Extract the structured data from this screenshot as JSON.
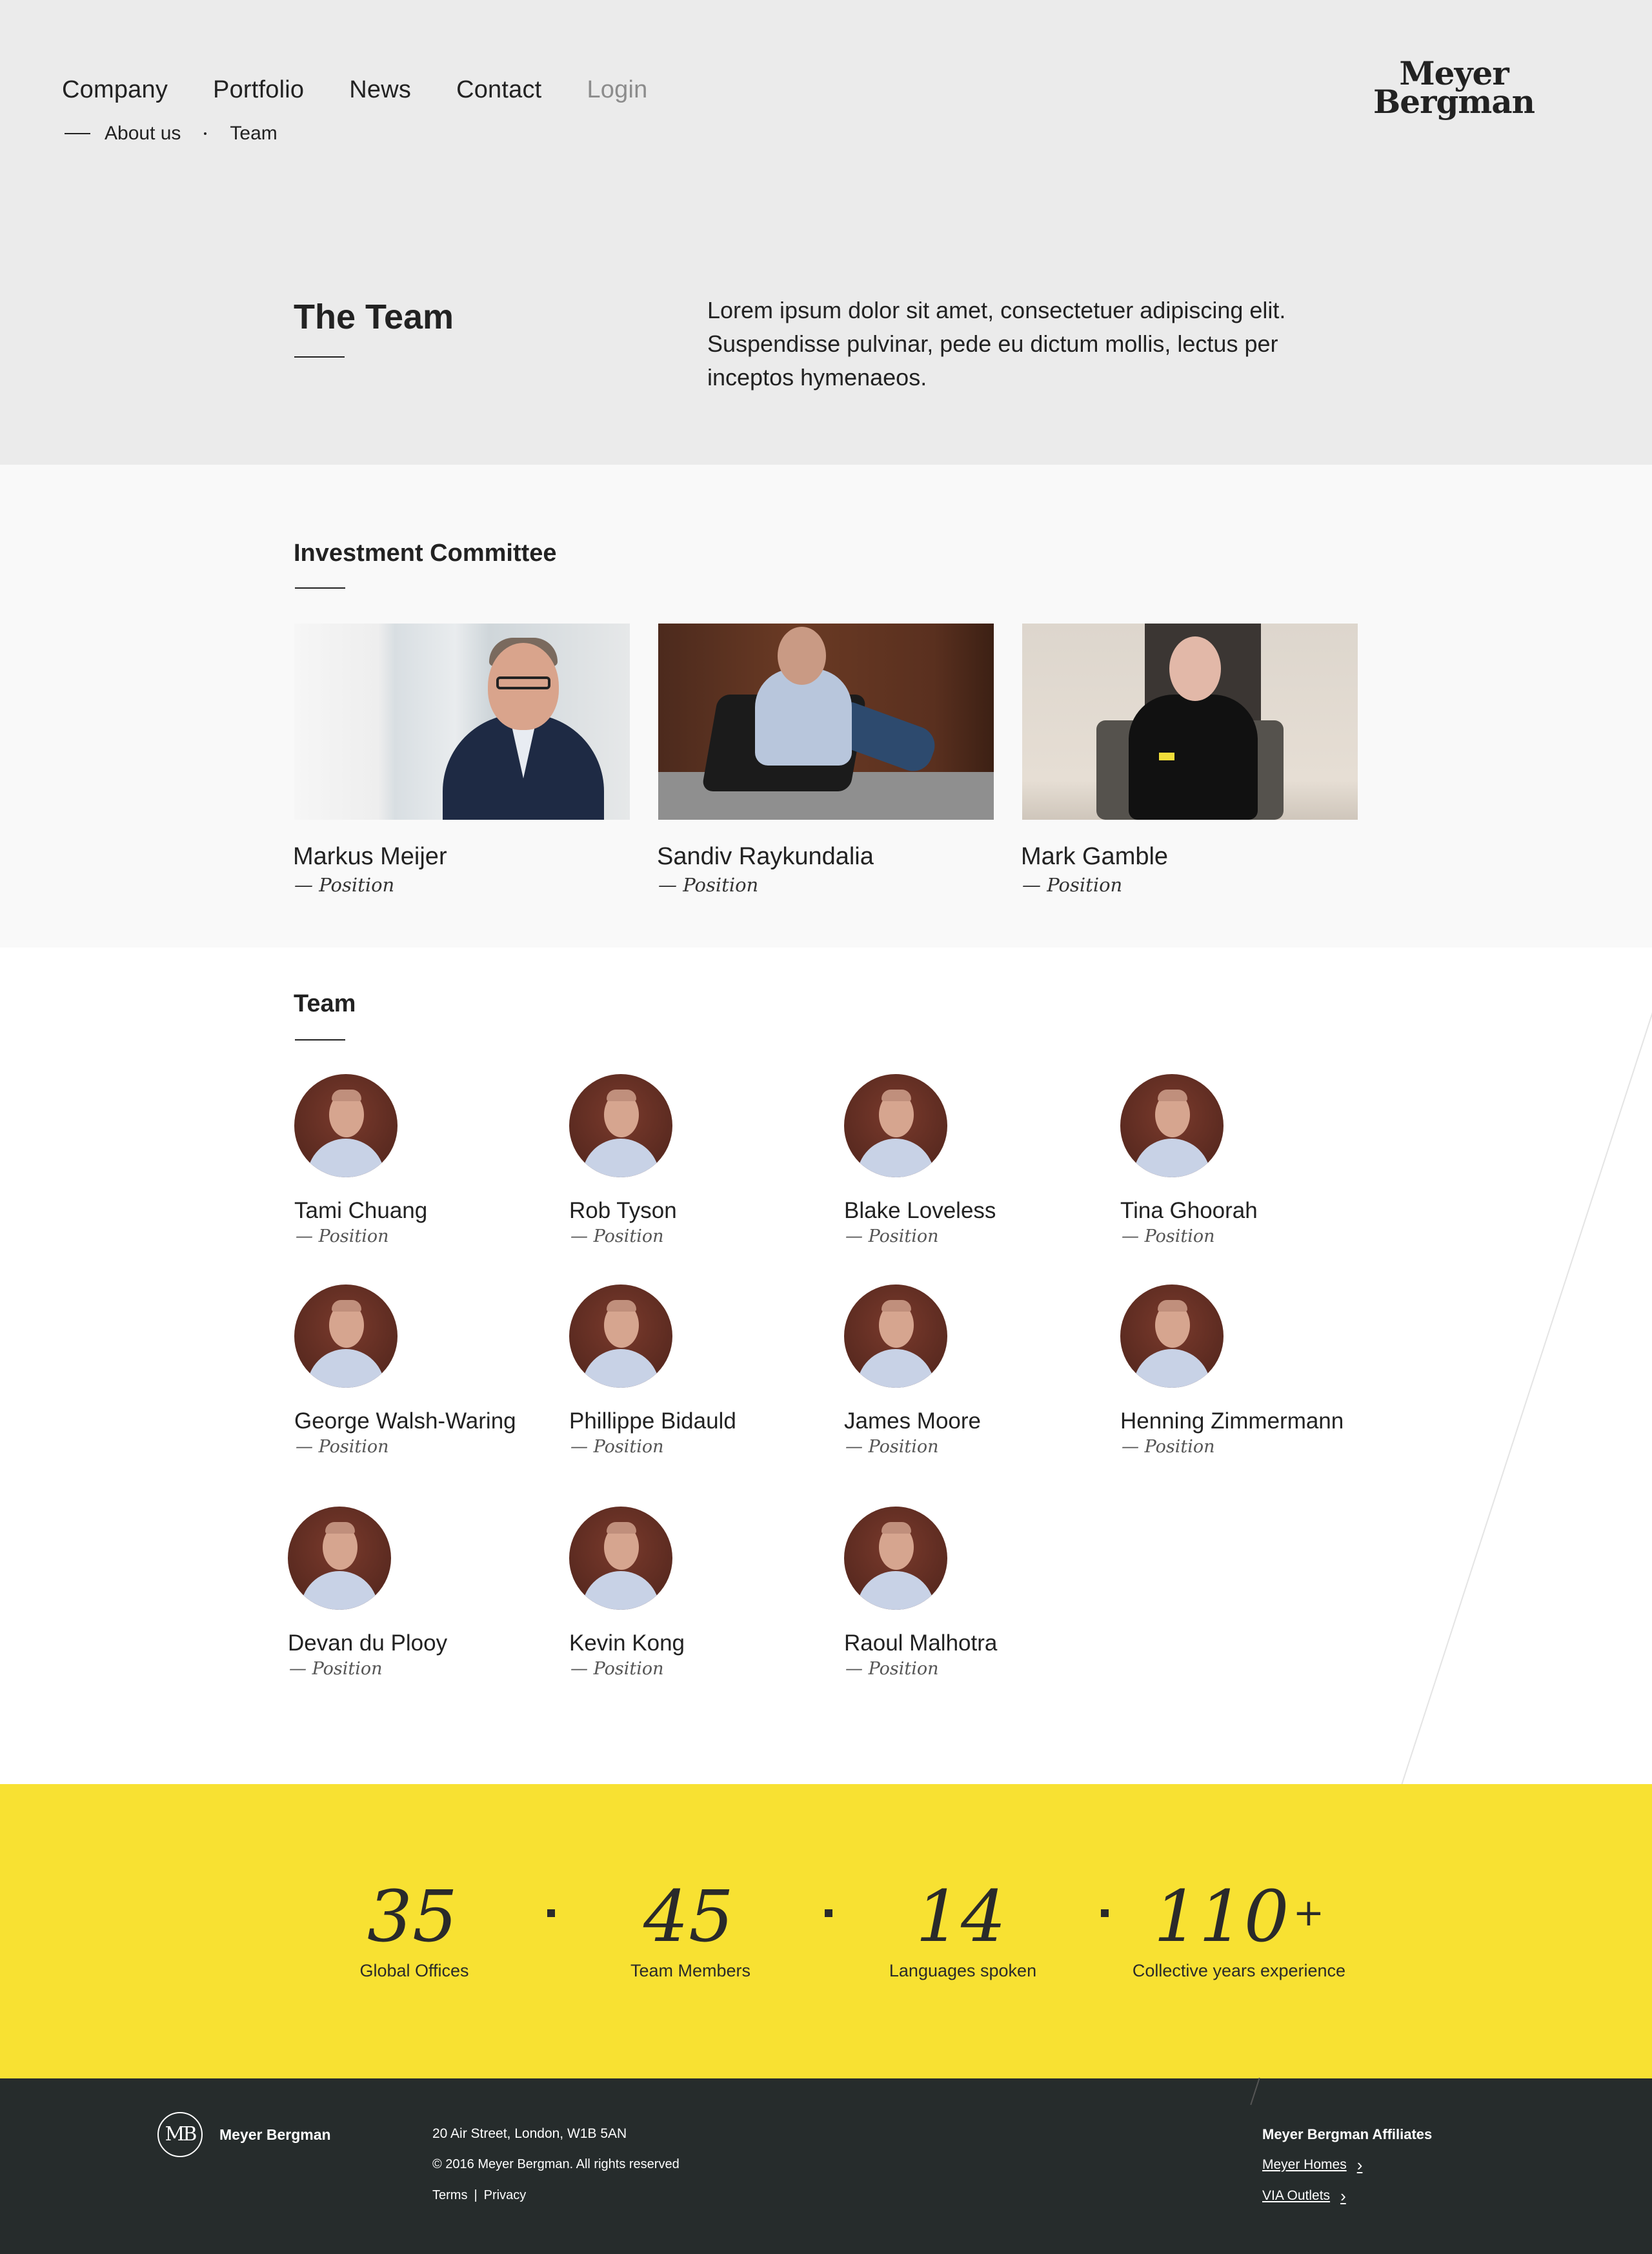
{
  "nav": {
    "items": [
      {
        "label": "Company",
        "muted": false
      },
      {
        "label": "Portfolio",
        "muted": false
      },
      {
        "label": "News",
        "muted": false
      },
      {
        "label": "Contact",
        "muted": false
      },
      {
        "label": "Login",
        "muted": true
      }
    ],
    "sub": [
      "About us",
      "Team"
    ]
  },
  "logo": {
    "line1": "Meyer",
    "line2": "Bergman"
  },
  "hero": {
    "title": "The Team",
    "text": "Lorem ipsum dolor sit amet, consectetuer adipiscing elit. Suspendisse pulvinar, pede eu dictum mollis, lectus per inceptos hymenaeos."
  },
  "committee": {
    "title": "Investment Committee",
    "members": [
      {
        "name": "Markus Meijer",
        "position": "— Position"
      },
      {
        "name": "Sandiv Raykundalia",
        "position": "— Position"
      },
      {
        "name": "Mark Gamble",
        "position": "— Position"
      }
    ]
  },
  "team": {
    "title": "Team",
    "members": [
      {
        "name": "Tami Chuang",
        "position": "— Position"
      },
      {
        "name": "Rob Tyson",
        "position": "— Position"
      },
      {
        "name": "Blake Loveless",
        "position": "— Position"
      },
      {
        "name": "Tina Ghoorah",
        "position": "— Position"
      },
      {
        "name": "George Walsh-Waring",
        "position": "— Position"
      },
      {
        "name": "Phillippe Bidauld",
        "position": "— Position"
      },
      {
        "name": "James Moore",
        "position": "— Position"
      },
      {
        "name": "Henning Zimmermann",
        "position": "— Position"
      },
      {
        "name": "Devan du Plooy",
        "position": "— Position"
      },
      {
        "name": "Kevin Kong",
        "position": "— Position"
      },
      {
        "name": "Raoul Malhotra",
        "position": "— Position"
      }
    ]
  },
  "stats": [
    {
      "value": "35",
      "suffix": "",
      "label": "Global Offices"
    },
    {
      "value": "45",
      "suffix": "",
      "label": "Team Members"
    },
    {
      "value": "14",
      "suffix": "",
      "label": "Languages spoken"
    },
    {
      "value": "110",
      "suffix": "+",
      "label": "Collective years experience"
    }
  ],
  "footer": {
    "monogram": "MB",
    "brand": "Meyer Bergman",
    "address": "20 Air Street, London, W1B 5AN",
    "copyright": "© 2016 Meyer Bergman. All rights reserved",
    "terms": "Terms",
    "separator": "|",
    "privacy": "Privacy",
    "affiliates_title": "Meyer Bergman Affiliates",
    "affiliates": [
      "Meyer Homes",
      "VIA Outlets"
    ]
  },
  "colors": {
    "header_bg": "#ebebeb",
    "stats_bg": "#f8e132",
    "footer_bg": "#262c2c"
  }
}
